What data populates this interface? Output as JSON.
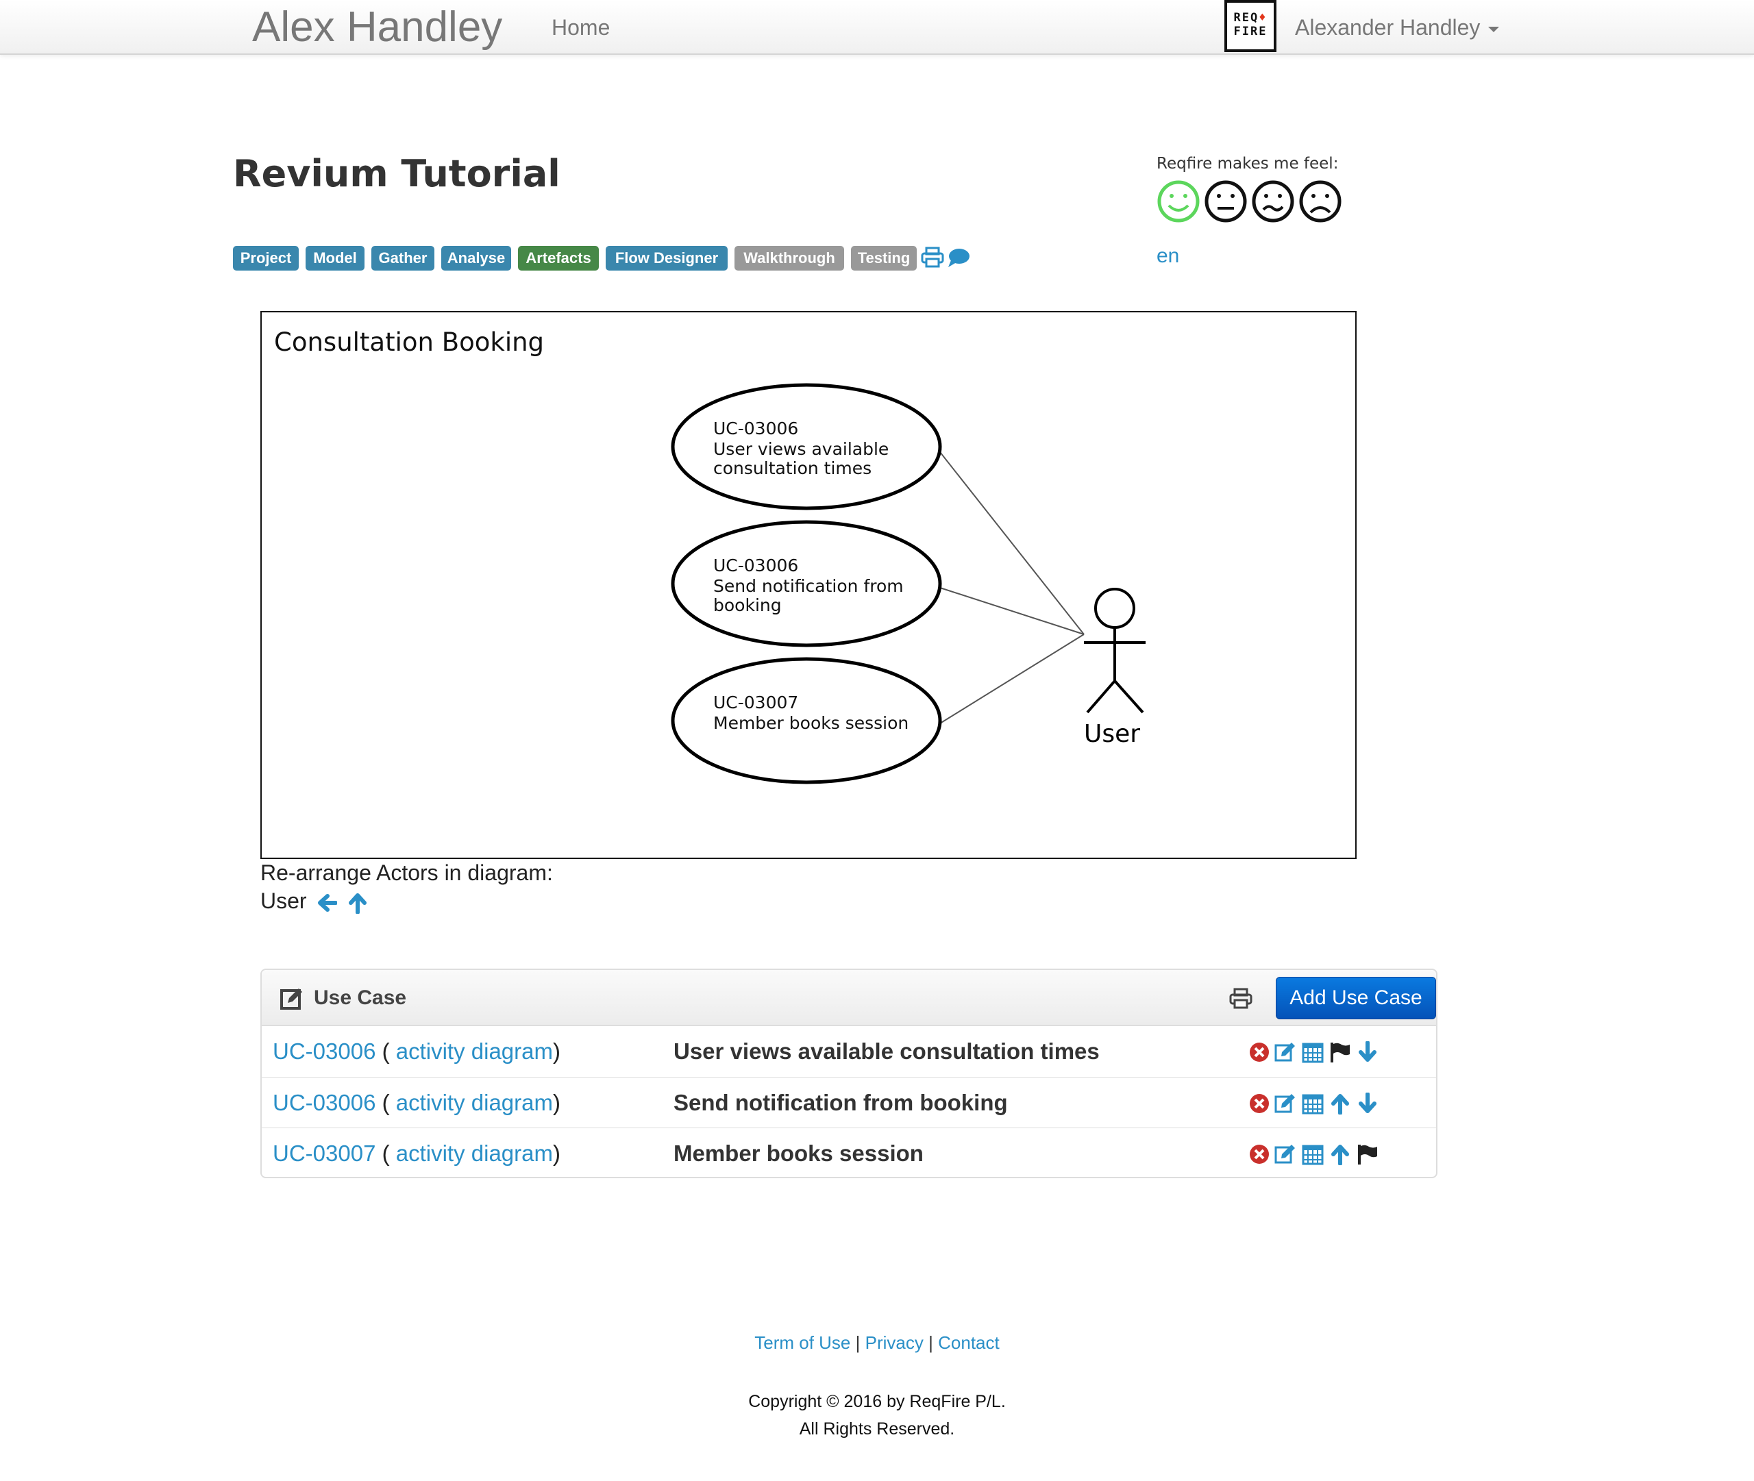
{
  "navbar": {
    "brand": "Alex Handley",
    "home": "Home",
    "logo_line1": "REQ",
    "logo_line2": "FIRE",
    "user": "Alexander Handley"
  },
  "page": {
    "title": "Revium Tutorial",
    "feel_label": "Reqfire makes me feel:",
    "language": "en"
  },
  "tabs": [
    {
      "label": "Project",
      "color": "#3a87ad"
    },
    {
      "label": "Model",
      "color": "#3a87ad"
    },
    {
      "label": "Gather",
      "color": "#3a87ad"
    },
    {
      "label": "Analyse",
      "color": "#3a87ad"
    },
    {
      "label": "Artefacts",
      "color": "#468847"
    },
    {
      "label": "Flow Designer",
      "color": "#3a87ad"
    },
    {
      "label": "Walkthrough",
      "color": "#999999"
    },
    {
      "label": "Testing",
      "color": "#999999"
    }
  ],
  "diagram": {
    "title": "Consultation Booking",
    "use_cases": [
      {
        "id": "UC-03006",
        "line1": "User views available",
        "line2": "consultation times"
      },
      {
        "id": "UC-03006",
        "line1": "Send notification from",
        "line2": "booking"
      },
      {
        "id": "UC-03007",
        "line1": "Member books session",
        "line2": ""
      }
    ],
    "actor": "User"
  },
  "rearrange": {
    "label": "Re-arrange Actors in diagram:",
    "actor": "User"
  },
  "use_case_panel": {
    "title": "Use Case",
    "add_button": "Add Use Case",
    "activity_link": "activity diagram",
    "rows": [
      {
        "id": "UC-03006",
        "name": "User views available consultation times"
      },
      {
        "id": "UC-03006",
        "name": "Send notification from booking"
      },
      {
        "id": "UC-03007",
        "name": "Member books session"
      }
    ]
  },
  "footer": {
    "terms": "Term of Use",
    "privacy": "Privacy",
    "contact": "Contact",
    "separator": "|",
    "copyright": "Copyright © 2016 by ReqFire P/L.",
    "rights": "All Rights Reserved."
  },
  "colors": {
    "link": "#2a8fc7",
    "primary_button": "#0a6ad0",
    "delete_icon": "#c9302c",
    "happy_face": "#5cd65c"
  }
}
